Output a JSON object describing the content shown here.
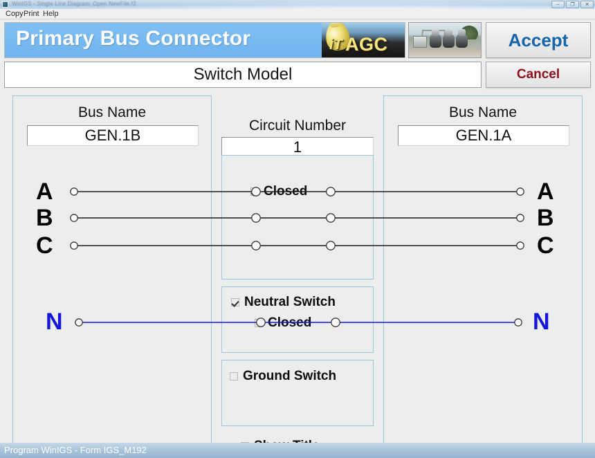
{
  "window": {
    "title": "WinIGS - Single Line Diagram: Open NewFile.f2",
    "controls": [
      {
        "name": "minimize-button",
        "glyph": "–"
      },
      {
        "name": "maximize-button",
        "glyph": "❐"
      },
      {
        "name": "close-button",
        "glyph": "✕"
      }
    ]
  },
  "menu": {
    "copy": "Copy",
    "print": "Print",
    "help": "Help"
  },
  "header": {
    "banner_title": "Primary Bus Connector",
    "logo_it": "iT",
    "logo_agc": "AGC",
    "model_label": "Switch Model"
  },
  "actions": {
    "accept": "Accept",
    "cancel": "Cancel"
  },
  "left_bus": {
    "heading": "Bus Name",
    "value": "GEN.1B"
  },
  "right_bus": {
    "heading": "Bus Name",
    "value": "GEN.1A"
  },
  "circuit": {
    "heading": "Circuit Number",
    "value": "1"
  },
  "checkboxes": {
    "closed": {
      "label": "Closed",
      "checked": true
    },
    "neutral_switch": {
      "label": "Neutral Switch",
      "checked": true
    },
    "neutral_closed": {
      "label": "Closed",
      "checked": false
    },
    "ground_switch": {
      "label": "Ground Switch",
      "checked": false
    },
    "show_title": {
      "label": "Show Title",
      "checked": false
    }
  },
  "phases": {
    "left": [
      "A",
      "B",
      "C"
    ],
    "right": [
      "A",
      "B",
      "C"
    ],
    "neutral_left": "N",
    "neutral_right": "N"
  },
  "colors": {
    "banner": "#79bbf2",
    "accept_text": "#1565a8",
    "cancel_text": "#8e1220",
    "neutral_line": "#1414dd",
    "phase_line": "#1a1a1a",
    "panel_border": "#9fc4dc"
  },
  "statusbar": {
    "text": "Program WinIGS - Form IGS_M192"
  }
}
